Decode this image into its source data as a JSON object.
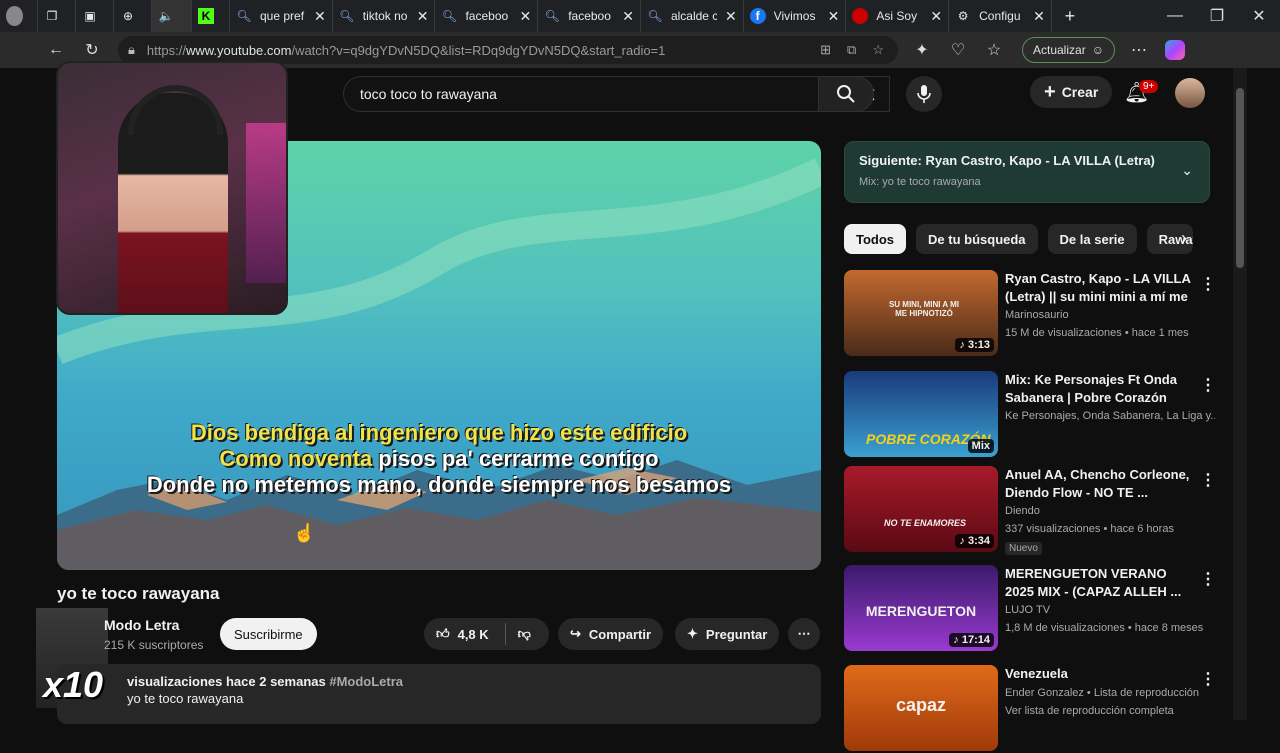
{
  "browser": {
    "tabs": [
      {
        "label": "",
        "icon": "profile-icon"
      },
      {
        "label": "",
        "icon": "workspaces-icon"
      },
      {
        "label": "",
        "icon": "tab-actions-icon"
      },
      {
        "label": "",
        "icon": "globe-icon"
      },
      {
        "label": "",
        "icon": "speaker-icon"
      },
      {
        "label": "",
        "icon": "kick-icon"
      },
      {
        "label": "que pref",
        "icon": "search-icon"
      },
      {
        "label": "tiktok no",
        "icon": "search-icon"
      },
      {
        "label": "faceboo",
        "icon": "search-icon"
      },
      {
        "label": "faceboo",
        "icon": "search-icon"
      },
      {
        "label": "alcalde c",
        "icon": "search-icon"
      },
      {
        "label": "Vivimos",
        "icon": "facebook-icon"
      },
      {
        "label": "Asi Soy",
        "icon": "red-icon"
      },
      {
        "label": "Configu",
        "icon": "gear-icon"
      }
    ],
    "url_prefix": "https://",
    "url_host": "www.youtube.com",
    "url_rest": "/watch?v=q9dgYDvN5DQ&list=RDq9dgYDvN5DQ&start_radio=1",
    "update_label": "Actualizar"
  },
  "youtube": {
    "search_query": "toco toco to rawayana",
    "create_label": "Crear",
    "notification_count": "9+",
    "lyrics": {
      "line1": "Dios bendiga al ingeniero que hizo este edificio",
      "line2_hl": "Como noventa",
      "line2_rest": " pisos pa' cerrarme contigo",
      "line3": "Donde no metemos mano, donde siempre nos besamos"
    },
    "video_title": "yo te toco rawayana",
    "channel_name": "Modo Letra",
    "subscribers": "215 K suscriptores",
    "subscribe_label": "Suscribirme",
    "likes": "4,8 K",
    "share_label": "Compartir",
    "ask_label": "Preguntar",
    "desc_meta": "visualizaciones  hace 2 semanas",
    "desc_tag": "#ModoLetra",
    "desc_line2": "yo te toco rawayana",
    "overlay_text": "x10",
    "next": {
      "title": "Siguiente: Ryan Castro, Kapo - LA VILLA (Letra) || s...",
      "sub": "Mix: yo te toco rawayana"
    },
    "chips": [
      "Todos",
      "De tu búsqueda",
      "De la serie",
      "Raway"
    ],
    "recommendations": [
      {
        "title": "Ryan Castro, Kapo - LA VILLA (Letra) || su mini mini a mí me ...",
        "channel": "Marinosaurio",
        "meta": "15 M de visualizaciones • hace 1 mes",
        "duration": "♪ 3:13",
        "thumb_text": "SU MINI, MINI A MI ME HIPNOTIZÓ",
        "badge": ""
      },
      {
        "title": "Mix: Ke Personajes Ft  Onda Sabanera | Pobre Corazón",
        "channel": "Ke Personajes, Onda Sabanera, La Liga y...",
        "meta": "",
        "duration": "Mix",
        "thumb_text": "POBRE CORAZÓN",
        "badge": ""
      },
      {
        "title": "Anuel AA, Chencho Corleone, Diendo Flow - NO TE ...",
        "channel": "Diendo",
        "meta": "337 visualizaciones • hace 6 horas",
        "duration": "♪ 3:34",
        "thumb_text": "NO TE ENAMORES",
        "badge": "Nuevo"
      },
      {
        "title": "MERENGUETON VERANO 2025 MIX - (CAPAZ ALLEH ...",
        "channel": "LUJO TV",
        "meta": "1,8 M de visualizaciones • hace 8 meses",
        "duration": "♪ 17:14",
        "thumb_text": "MERENGUETON",
        "badge": ""
      },
      {
        "title": "Venezuela",
        "channel": "Ender Gonzalez • Lista de reproducción",
        "meta": "Ver lista de reproducción completa",
        "duration": "",
        "thumb_text": "capaz",
        "badge": ""
      }
    ]
  },
  "colors": {
    "accent_green": "#1e3a33",
    "lyric_highlight": "#f0e44a",
    "notification_red": "#cc0000"
  }
}
